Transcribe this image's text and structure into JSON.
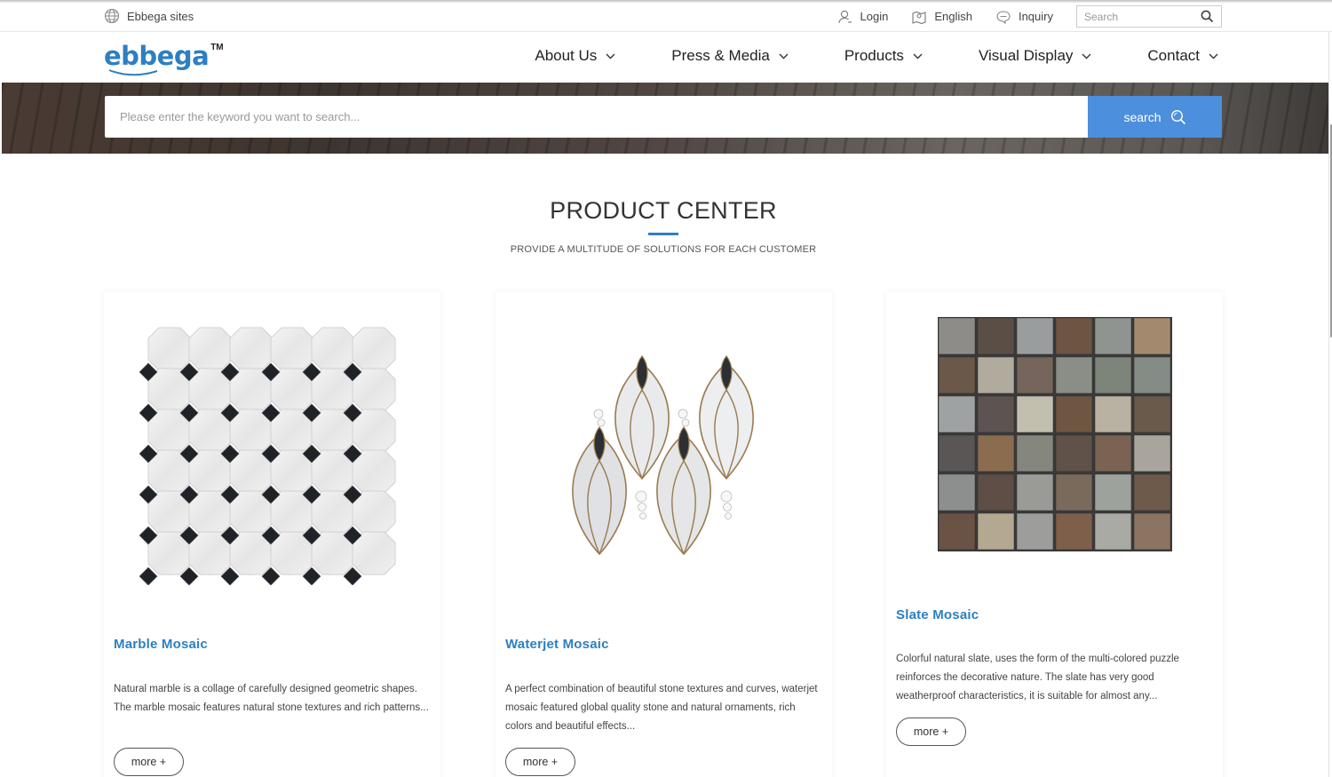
{
  "utility": {
    "sites_label": "Ebbega sites",
    "login_label": "Login",
    "language_label": "English",
    "inquiry_label": "Inquiry",
    "search_placeholder": "Search"
  },
  "nav": {
    "logo_text": "ebbega",
    "logo_tm": "TM",
    "items": [
      {
        "label": "About Us"
      },
      {
        "label": "Press & Media"
      },
      {
        "label": "Products"
      },
      {
        "label": "Visual Display"
      },
      {
        "label": "Contact"
      }
    ]
  },
  "banner": {
    "search_placeholder": "Please enter the keyword you want to search...",
    "search_button": "search"
  },
  "section": {
    "title": "PRODUCT CENTER",
    "subtitle": "PROVIDE A MULTITUDE OF SOLUTIONS FOR EACH CUSTOMER"
  },
  "products": [
    {
      "title": "Marble Mosaic",
      "description": "Natural marble is a collage of carefully designed geometric shapes. The marble mosaic features natural stone textures and rich patterns...",
      "more_label": "more +"
    },
    {
      "title": "Waterjet Mosaic",
      "description": "A perfect combination of beautiful stone textures and curves, waterjet mosaic featured global quality stone and natural ornaments, rich colors and beautiful effects...",
      "more_label": "more +"
    },
    {
      "title": "Slate Mosaic",
      "description": "Colorful natural slate, uses the form of the multi-colored puzzle reinforces the decorative nature. The slate has very good weatherproof characteristics, it is suitable for almost any...",
      "more_label": "more +"
    }
  ],
  "colors": {
    "brand_blue": "#2d7fc1",
    "button_blue": "#4c8fdc"
  }
}
